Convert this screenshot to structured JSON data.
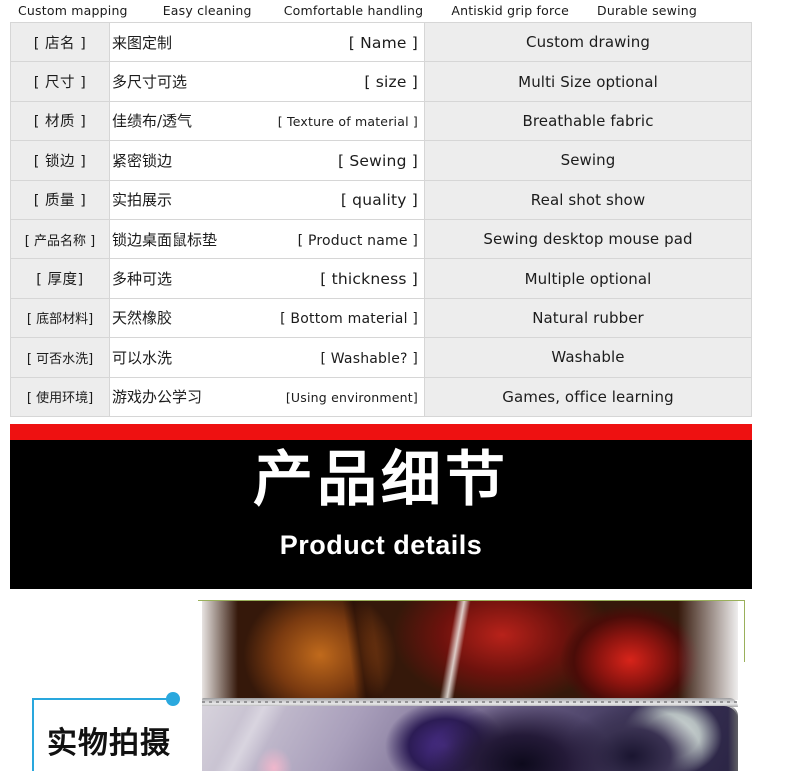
{
  "features": [
    "Custom mapping",
    "Easy cleaning",
    "Comfortable handling",
    "Antiskid grip force",
    "Durable sewing"
  ],
  "spec_groups": [
    {
      "rows": [
        {
          "key": "[ 店名 ]",
          "cn": "来图定制",
          "en": "[  Name  ]",
          "value": "Custom drawing"
        },
        {
          "key": "[ 尺寸 ]",
          "cn": "多尺寸可选",
          "en": "[   size  ]",
          "value": "Multi Size optional"
        },
        {
          "key": "[ 材质 ]",
          "cn": "佳绩布/透气",
          "en": "[ Texture of material ]",
          "value": "Breathable fabric"
        },
        {
          "key": "[ 锁边 ]",
          "cn": "紧密锁边",
          "en": "[  Sewing   ]",
          "value": "Sewing"
        },
        {
          "key": "[ 质量 ]",
          "cn": "实拍展示",
          "en": "[  quality   ]",
          "value": "Real shot show"
        }
      ]
    },
    {
      "rows": [
        {
          "key": "[ 产品名称 ]",
          "cn": "锁边桌面鼠标垫",
          "en": "[ Product name ]",
          "value": "Sewing desktop mouse pad"
        },
        {
          "key": "[ 厚度]",
          "cn": "多种可选",
          "en": "[  thickness ]",
          "value": "Multiple optional"
        },
        {
          "key": "[ 底部材料]",
          "cn": "天然橡胶",
          "en": "[  Bottom material ]",
          "value": "Natural rubber"
        },
        {
          "key": "[ 可否水洗]",
          "cn": "可以水洗",
          "en": "[  Washable?  ]",
          "value": "Washable"
        },
        {
          "key": "[ 使用环境]",
          "cn": "游戏办公学习",
          "en": "[Using environment]",
          "value": "Games, office learning"
        }
      ]
    }
  ],
  "banner": {
    "title": "产品细节",
    "subtitle": "Product details",
    "background_color": "#000000",
    "stripe_color": "#ee1111",
    "text_color": "#ffffff"
  },
  "photo_section": {
    "caption": "实物拍摄",
    "accent_color": "#2aa8de",
    "bracket_color": "#9ab05b"
  }
}
